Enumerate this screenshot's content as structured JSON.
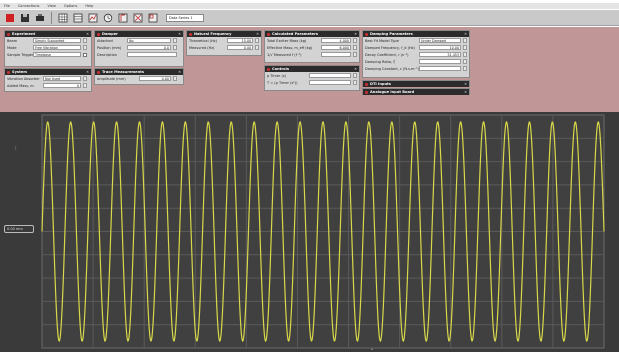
{
  "menu": [
    "File",
    "Connections",
    "View",
    "Options",
    "Help"
  ],
  "toolbar": {
    "select_value": "Data Series 1",
    "colors": {
      "record": "#d02020",
      "accent": "#c03030"
    }
  },
  "panels": {
    "experiment": {
      "title": "Experiment",
      "rows": [
        {
          "label": "Beam",
          "value": "Simply Supported"
        },
        {
          "label": "Mode",
          "value": "Free Vibration"
        },
        {
          "label": "Sample Trigger",
          "value": "Timebase"
        }
      ]
    },
    "system": {
      "title": "System",
      "rows": [
        {
          "label": "Vibration Absorber",
          "value": "Not Used"
        },
        {
          "label": "Added Mass, m",
          "value": "0"
        }
      ]
    },
    "damper": {
      "title": "Damper",
      "rows": [
        {
          "label": "Attached",
          "value": "No"
        },
        {
          "label": "Position  (mm)",
          "value": "0.0"
        },
        {
          "label": "Description",
          "value": ""
        }
      ]
    },
    "trace": {
      "title": "Trace Measurements",
      "rows": [
        {
          "label": "Amplitude  (mm)",
          "value": "0.00"
        }
      ]
    },
    "natural_frequency": {
      "title": "Natural Frequency",
      "rows": [
        {
          "label": "Theoretical  (Hz)",
          "value": "15.00"
        },
        {
          "label": "Measured  (Hz)",
          "value": "0.00"
        }
      ]
    },
    "calculated": {
      "title": "Calculated Parameters",
      "rows": [
        {
          "label": "Total Exciter Mass  (kg)",
          "value": "4.000"
        },
        {
          "label": "Effective Mass, m_eff (kg)",
          "value": "6.000"
        },
        {
          "label": "1/√ Measured f (f⁻²)",
          "value": ""
        }
      ]
    },
    "controls": {
      "title": "Controls",
      "rows": [
        {
          "label": "p Timer  (s)",
          "value": ""
        },
        {
          "label": "T = (p Timer  (s²))",
          "value": ""
        }
      ]
    },
    "damping": {
      "title": "Damping Parameters",
      "rows": [
        {
          "label": "Best Fit Model Type",
          "value": "Under Damped"
        },
        {
          "label": "Damped Frequency, f_d  (Hz)",
          "value": "10.00"
        },
        {
          "label": "Decay Coefficient, r (s⁻¹)",
          "value": "51.453"
        },
        {
          "label": "Damping Ratio, ζ",
          "value": ""
        },
        {
          "label": "Damping Constant, c  (N.s.m⁻¹)",
          "value": ""
        }
      ]
    },
    "dti": {
      "title": "DTI Inputs"
    },
    "analogue": {
      "title": "Analogue Input Board"
    }
  },
  "plot": {
    "cursor_label": "0.00 mm",
    "colors": {
      "background": "#3a3a3a",
      "grid": "#5a5a5a",
      "trace": "#d8d84a",
      "panel_strip": "#c09696"
    }
  },
  "chart_data": {
    "type": "line",
    "title": "",
    "xlabel": "",
    "ylabel": "",
    "series": [
      {
        "waveform": "sine",
        "cycles": 24.5,
        "amplitude_relative": 1.0
      }
    ],
    "grid": true
  }
}
